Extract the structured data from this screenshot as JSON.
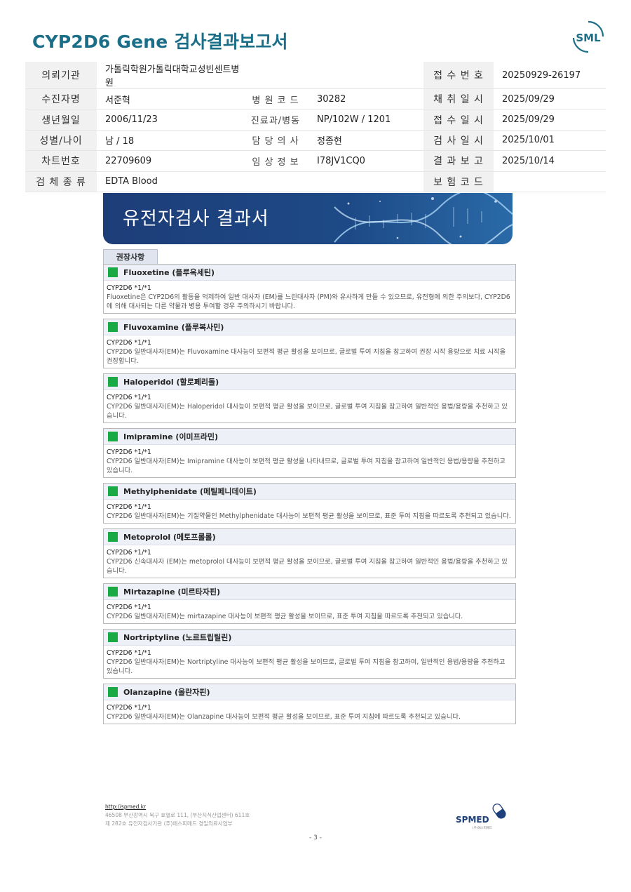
{
  "title": "CYP2D6 Gene 검사결과보고서",
  "logo_text": "SML",
  "info": {
    "rows": [
      [
        {
          "label": "의뢰기관",
          "value": "가톨릭학원가톨릭대학교성빈센트병원"
        },
        {
          "label": "",
          "value": ""
        },
        {
          "label": "접 수 번 호",
          "value": "20250929-26197"
        }
      ],
      [
        {
          "label": "수진자명",
          "value": "서준혁"
        },
        {
          "label": "병 원 코 드",
          "value": "30282"
        },
        {
          "label": "채 취 일 시",
          "value": "2025/09/29"
        }
      ],
      [
        {
          "label": "생년월일",
          "value": "2006/11/23"
        },
        {
          "label": "진료과/병동",
          "value": "NP/102W / 1201"
        },
        {
          "label": "접 수 일 시",
          "value": "2025/09/29"
        }
      ],
      [
        {
          "label": "성별/나이",
          "value": "남 / 18"
        },
        {
          "label": "담 당 의 사",
          "value": "정종현"
        },
        {
          "label": "검 사 일 시",
          "value": "2025/10/01"
        }
      ],
      [
        {
          "label": "차트번호",
          "value": "22709609"
        },
        {
          "label": "임 상 정 보",
          "value": "I78JV1CQ0"
        },
        {
          "label": "결 과 보 고",
          "value": "2025/10/14"
        }
      ],
      [
        {
          "label": "검 체 종 류",
          "value": "EDTA Blood"
        },
        {
          "label": "",
          "value": ""
        },
        {
          "label": "보 험 코 드",
          "value": ""
        }
      ]
    ]
  },
  "banner_title": "유전자검사 결과서",
  "tab_label": "권장사항",
  "recommendations": [
    {
      "drug": "Fluoxetine (플루옥세틴)",
      "genotype": "CYP2D6 *1/*1",
      "text": "Fluoxetine은 CYP2D6의 활동을 억제하여 일반 대사자 (EM)를 느린대사자 (PM)와 유사하게 만들 수 있으므로, 유전형에 의한 주의보다, CYP2D6에 의해 대사되는 다른 약물과 병용 투여할 경우 주의하시기 바랍니다."
    },
    {
      "drug": "Fluvoxamine (플루복사민)",
      "genotype": "CYP2D6 *1/*1",
      "text": "CYP2D6 일반대사자(EM)는 Fluvoxamine 대사능이 보편적 평균 활성을 보이므로, 글로벌 투여 지침을 참고하여 권장 시작 용량으로 치료 시작을 권장합니다."
    },
    {
      "drug": "Haloperidol (할로페리돌)",
      "genotype": "CYP2D6 *1/*1",
      "text": "CYP2D6 일반대사자(EM)는 Haloperidol 대사능이 보편적 평균 활성을 보이므로, 글로벌 투여 지침을 참고하여 일반적인 용법/용량을 추천하고 있습니다."
    },
    {
      "drug": "Imipramine (이미프라민)",
      "genotype": "CYP2D6 *1/*1",
      "text": "CYP2D6 일반대사자(EM)는 Imipramine 대사능이 보편적 평균 활성을 나타내므로, 글로벌 투여 지침을 참고하여 일반적인 용법/용량을 추천하고 있습니다."
    },
    {
      "drug": "Methylphenidate (메틸페니데이트)",
      "genotype": "CYP2D6 *1/*1",
      "text": "CYP2D6 일반대사자(EM)는 기질약물인 Methylphenidate 대사능이 보편적 평균 활성을 보이므로, 표준 투여 지침을 따르도록 추천되고 있습니다."
    },
    {
      "drug": "Metoprolol (메토프롤롤)",
      "genotype": "CYP2D6 *1/*1",
      "text": "CYP2D6 신속대사자 (EM)는 metoprolol 대사능이 보편적 평균 활성을 보이므로, 글로벌 투여 지침을 참고하여 일반적인 용법/용량을 추천하고 있습니다."
    },
    {
      "drug": "Mirtazapine (미르타자핀)",
      "genotype": "CYP2D6 *1/*1",
      "text": "CYP2D6 일반대사자(EM)는 mirtazapine 대사능이 보편적 평균 활성을 보이므로, 표준 투여 지침을 따르도록 추천되고 있습니다."
    },
    {
      "drug": "Nortriptyline (노르트립틸린)",
      "genotype": "CYP2D6 *1/*1",
      "text": "CYP2D6 일반대사자(EM)는 Nortriptyline 대사능이 보편적 평균 활성을 보이므로, 글로벌 투여 지침을 참고하여, 일반적인 용법/용량을 추천하고 있습니다."
    },
    {
      "drug": "Olanzapine (올란자핀)",
      "genotype": "CYP2D6 *1/*1",
      "text": "CYP2D6 일반대사자(EM)는 Olanzapine 대사능이 보편적 평균 활성을 보이므로, 표준 투여 지침에 따르도록 추천되고 있습니다."
    }
  ],
  "footer": {
    "url": "http://spmed.kr",
    "address": "46508 부산광역시 북구 효열로 111, (부산지식산업센터) 611호",
    "registration": "제 282호 유전자검사기관 (주)에스피메드 경일의료사업부",
    "logo_text": "SPMED",
    "logo_sub": "(주)에스피메드"
  },
  "page_number": "- 3 -"
}
